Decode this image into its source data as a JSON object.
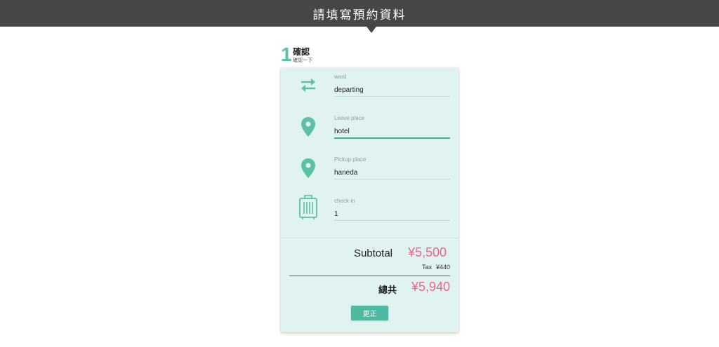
{
  "header": {
    "title": "請填寫預約資料"
  },
  "step": {
    "number": "1",
    "title": "確認",
    "subtitle": "確認一下"
  },
  "fields": [
    {
      "label": "ward",
      "value": "departing",
      "icon": "swap-arrows-icon"
    },
    {
      "label": "Leave place",
      "value": "hotel",
      "icon": "location-pin-icon"
    },
    {
      "label": "Pickup place",
      "value": "haneda",
      "icon": "location-pin-icon"
    },
    {
      "label": "check-in",
      "value": "1",
      "icon": "luggage-icon"
    }
  ],
  "summary": {
    "subtotal_label": "Subtotal",
    "subtotal_value": "¥5,500",
    "tax_label": "Tax",
    "tax_value": "¥440",
    "total_label": "總共",
    "total_value": "¥5,940"
  },
  "actions": {
    "edit_label": "更正"
  },
  "colors": {
    "accent": "#5cc0a7",
    "price": "#f06488",
    "header_bg": "#464646",
    "card_bg": "#e0f3f0",
    "active_underline": "#3fb180"
  }
}
